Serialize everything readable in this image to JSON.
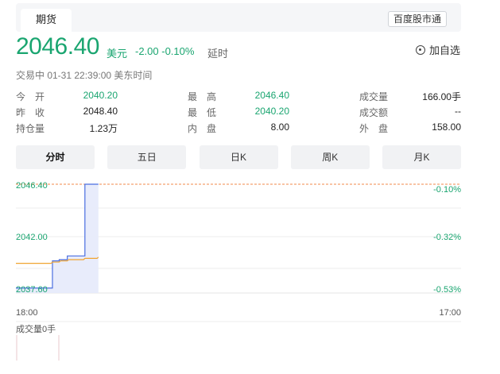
{
  "header": {
    "tab_label": "期货",
    "brand_badge": "百度股市通"
  },
  "quote": {
    "price": "2046.40",
    "currency": "美元",
    "change": "-2.00 -0.10%",
    "delay_label": "延时",
    "watch_label": "加自选",
    "status": "交易中  01-31 22:39:00  美东时间"
  },
  "stats": [
    [
      {
        "label": "今　开",
        "value": "2040.20",
        "color": "green"
      },
      {
        "label": "最　高",
        "value": "2046.40",
        "color": "green"
      },
      {
        "label": "成交量",
        "value": "166.00手",
        "color": "dark"
      }
    ],
    [
      {
        "label": "昨　收",
        "value": "2048.40",
        "color": "dark"
      },
      {
        "label": "最　低",
        "value": "2040.20",
        "color": "green"
      },
      {
        "label": "成交额",
        "value": "--",
        "color": "dark"
      }
    ],
    [
      {
        "label": "持仓量",
        "value": "1.23万",
        "color": "dark"
      },
      {
        "label": "内　盘",
        "value": "8.00",
        "color": "dark"
      },
      {
        "label": "外　盘",
        "value": "158.00",
        "color": "dark"
      }
    ]
  ],
  "periods": [
    {
      "label": "分时",
      "active": true
    },
    {
      "label": "五日",
      "active": false
    },
    {
      "label": "日K",
      "active": false
    },
    {
      "label": "周K",
      "active": false
    },
    {
      "label": "月K",
      "active": false
    }
  ],
  "chart_data": {
    "type": "line",
    "y_left_ticks": [
      "2046.40",
      "2042.00",
      "2037.60"
    ],
    "y_right_ticks": [
      "-0.10%",
      "-0.32%",
      "-0.53%"
    ],
    "x_ticks": [
      "18:00",
      "17:00"
    ],
    "ylim": [
      2037.6,
      2046.4
    ],
    "reference_price": 2048.4,
    "series": [
      {
        "values": [
          2038.0,
          2038.0,
          2038.0,
          2038.0,
          2038.0,
          2038.0,
          2038.0,
          2038.0,
          2038.0,
          2038.0,
          2038.0,
          2038.0,
          2038.0,
          2038.0,
          2038.0,
          2038.0,
          2038.0,
          2038.0,
          2038.0,
          2038.0,
          2038.0,
          2038.0,
          2038.0,
          2038.0,
          2038.0,
          2038.0,
          2038.0,
          2040.2,
          2040.2,
          2040.2,
          2040.2,
          2040.2,
          2040.3,
          2040.3,
          2040.3,
          2040.3,
          2040.3,
          2040.3,
          2040.6,
          2040.6,
          2040.6,
          2040.6,
          2040.6,
          2040.6,
          2040.6,
          2040.6,
          2040.6,
          2040.6,
          2040.6,
          2040.6,
          2040.6,
          2046.4,
          2046.4,
          2046.4,
          2046.4,
          2046.4,
          2046.4,
          2046.4,
          2046.4,
          2046.4,
          2046.4,
          2046.4
        ]
      },
      {
        "values": [
          2040.0,
          2040.0,
          2040.0,
          2040.0,
          2040.0,
          2040.0,
          2040.0,
          2040.0,
          2040.0,
          2040.0,
          2040.0,
          2040.0,
          2040.0,
          2040.0,
          2040.0,
          2040.0,
          2040.0,
          2040.0,
          2040.0,
          2040.0,
          2040.0,
          2040.0,
          2040.0,
          2040.0,
          2040.0,
          2040.0,
          2040.0,
          2040.1,
          2040.1,
          2040.1,
          2040.1,
          2040.1,
          2040.1,
          2040.2,
          2040.2,
          2040.2,
          2040.2,
          2040.2,
          2040.2,
          2040.3,
          2040.3,
          2040.3,
          2040.3,
          2040.3,
          2040.3,
          2040.3,
          2040.3,
          2040.3,
          2040.3,
          2040.3,
          2040.3,
          2040.4,
          2040.4,
          2040.4,
          2040.4,
          2040.4,
          2040.4,
          2040.4,
          2040.4,
          2040.4,
          2040.4,
          2040.5
        ]
      }
    ],
    "volume_label": "成交量0手",
    "colors": {
      "price_line": "#4a6ee0",
      "avg_line": "#f0a531",
      "ref_line": "#f08a4b",
      "fill": "#e6eafb",
      "grid": "#eeeeee",
      "up": "#1aa570"
    }
  }
}
